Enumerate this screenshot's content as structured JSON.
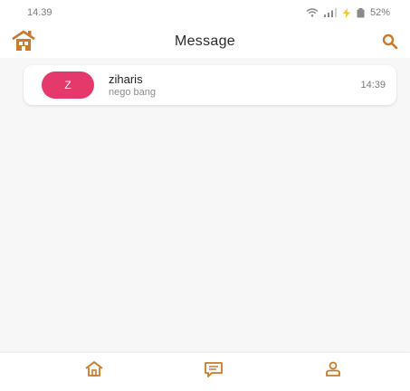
{
  "status_bar": {
    "time": "14.39",
    "battery": "52%",
    "icons": [
      "wifi-icon",
      "signal-icon",
      "charging-icon",
      "battery-icon"
    ]
  },
  "header": {
    "title": "Message",
    "logo_icon": "house-logo-icon",
    "search_icon": "search-icon"
  },
  "chats": [
    {
      "avatar_initial": "Z",
      "avatar_color": "#e6396b",
      "name": "ziharis",
      "preview": "nego bang",
      "time": "14:39"
    }
  ],
  "bottom_nav": {
    "items": [
      "home-icon",
      "message-icon",
      "profile-icon"
    ]
  },
  "colors": {
    "accent": "#c97a2a",
    "avatar": "#e6396b",
    "background": "#f7f7f7"
  }
}
